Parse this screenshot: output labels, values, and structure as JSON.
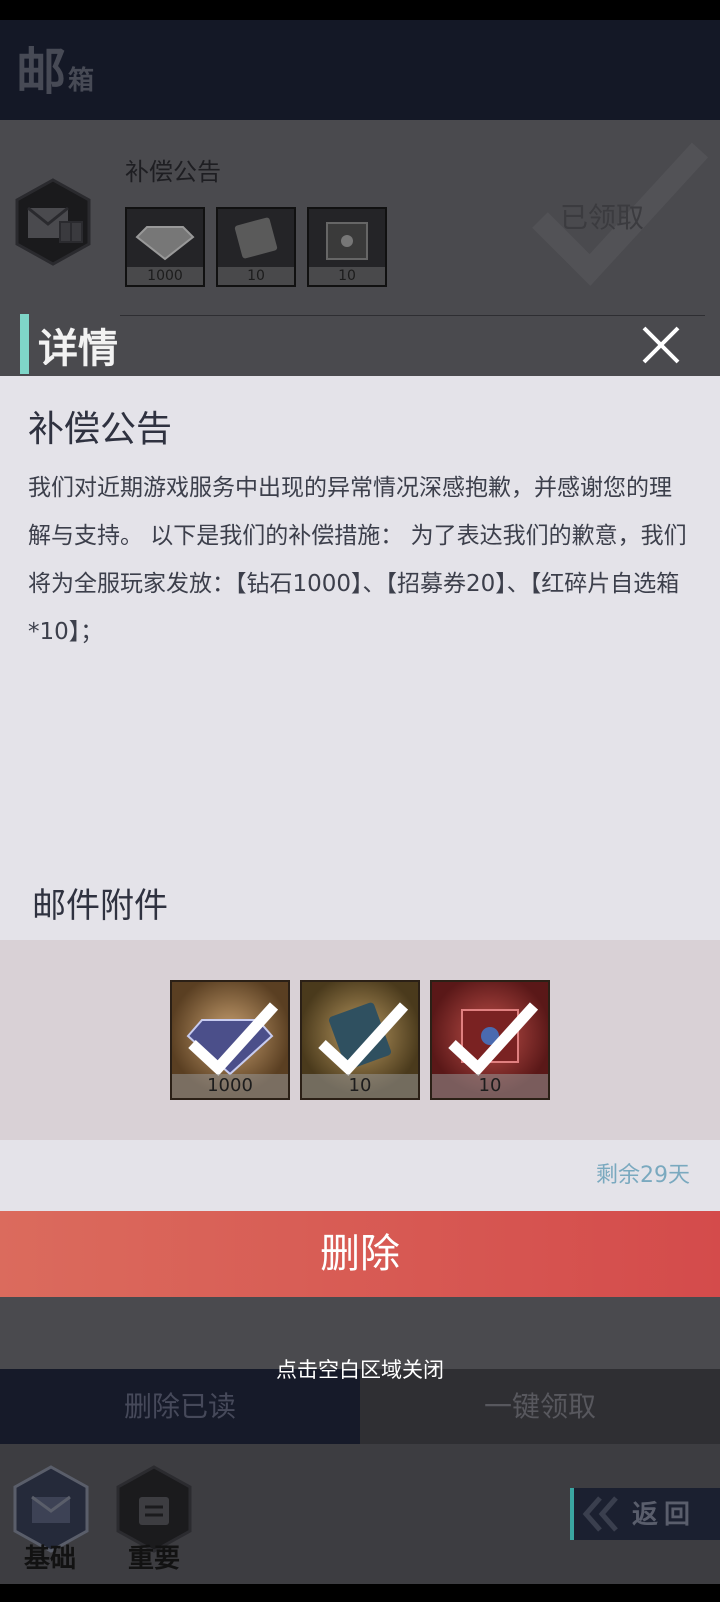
{
  "mailbox": {
    "title_main": "邮",
    "title_sub": "箱",
    "mail_item": {
      "subject": "补偿公告",
      "status": "已领取",
      "rewards": [
        {
          "count": "1000",
          "icon": "diamond-icon"
        },
        {
          "count": "10",
          "icon": "ticket-icon"
        },
        {
          "count": "10",
          "icon": "shard-box-icon"
        }
      ]
    },
    "footer": {
      "delete_read": "删除已读",
      "claim_all": "一键领取"
    },
    "nav": {
      "basic": "基础",
      "important": "重要",
      "back": "返回"
    }
  },
  "detail": {
    "header": "详情",
    "title": "补偿公告",
    "body": "我们对近期游戏服务中出现的异常情况深感抱歉，并感谢您的理解与支持。 以下是我们的补偿措施： 为了表达我们的歉意，我们将为全服玩家发放：【钻石1000】、【招募券20】、【红碎片自选箱*10】；",
    "attachments_title": "邮件附件",
    "attachments": [
      {
        "count": "1000",
        "icon": "diamond-icon",
        "claimed": true
      },
      {
        "count": "10",
        "icon": "ticket-icon",
        "claimed": true
      },
      {
        "count": "10",
        "icon": "red-shard-box-icon",
        "claimed": true
      }
    ],
    "remaining": "剩余29天",
    "delete_label": "删除",
    "close_hint": "点击空白区域关闭"
  },
  "colors": {
    "accent_teal": "#7fd6c8",
    "delete_red": "#d44b4b",
    "remaining_blue": "#7aa9bf"
  }
}
